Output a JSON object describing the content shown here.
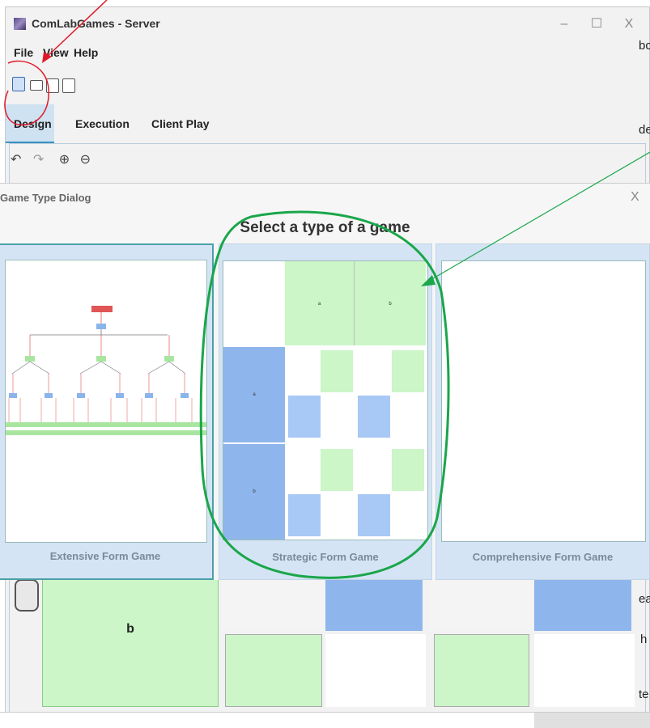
{
  "window": {
    "title": "ComLabGames - Server",
    "controls": {
      "minimize": "–",
      "maximize": "☐",
      "close": "X"
    }
  },
  "menu": {
    "file": "File",
    "view": "View",
    "help": "Help"
  },
  "toolbar": {
    "icons": [
      "new-file-icon",
      "open-folder-icon",
      "print-icon",
      "save-icon"
    ]
  },
  "tabs": {
    "design": "Design",
    "execution": "Execution",
    "client_play": "Client Play"
  },
  "zoom_toolbar": {
    "undo": "↶",
    "redo": "↷",
    "zoom_in": "⊕",
    "zoom_out": "⊖"
  },
  "dialog": {
    "title": "Game Type Dialog",
    "close": "X",
    "heading": "Select a type of a game",
    "cards": [
      {
        "label": "Extensive Form Game"
      },
      {
        "label": "Strategic Form Game"
      },
      {
        "label": "Comprehensive Form Game"
      }
    ],
    "strategic_preview": {
      "col_labels": [
        "a",
        "b"
      ],
      "row_labels": [
        "a",
        "b"
      ]
    }
  },
  "background_grid": {
    "row_label": "b"
  },
  "right_edge_fragments": [
    "bc",
    "de",
    "ea",
    "h",
    "te"
  ],
  "colors": {
    "annotation_red": "#e0192a",
    "annotation_green": "#1aa64a",
    "card_bg": "#d4e4f4",
    "green_cell": "#ccf5c8",
    "blue_cell": "#a8c8f5"
  }
}
